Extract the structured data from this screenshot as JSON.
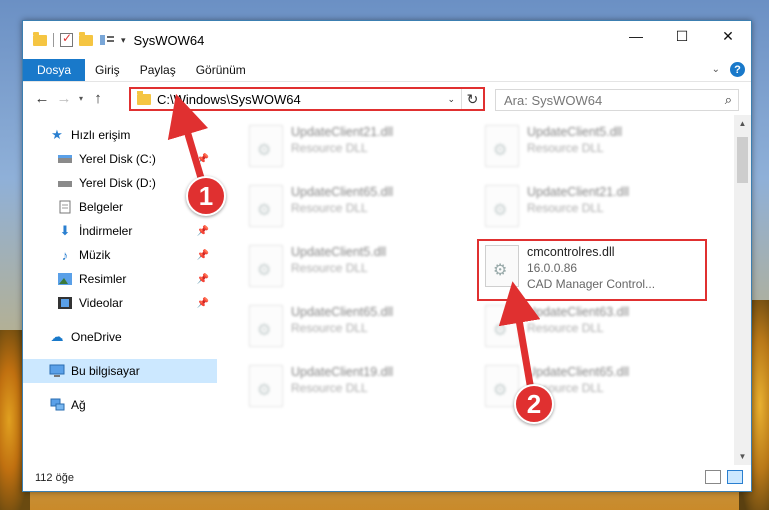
{
  "window": {
    "title": "SysWOW64",
    "controls": {
      "minimize": "—",
      "maximize": "☐",
      "close": "✕"
    }
  },
  "ribbon": {
    "tabs": [
      {
        "label": "Dosya",
        "active": true
      },
      {
        "label": "Giriş"
      },
      {
        "label": "Paylaş"
      },
      {
        "label": "Görünüm"
      }
    ],
    "help_icon": "?"
  },
  "address": {
    "path": "C:\\Windows\\SysWOW64",
    "search_placeholder": "Ara: SysWOW64"
  },
  "nav": {
    "quick_access": "Hızlı erişim",
    "items": [
      {
        "label": "Yerel Disk (C:)",
        "icon": "drive-icon",
        "pinned": true
      },
      {
        "label": "Yerel Disk (D:)",
        "icon": "drive-icon",
        "pinned": false
      },
      {
        "label": "Belgeler",
        "icon": "documents-icon",
        "pinned": true
      },
      {
        "label": "İndirmeler",
        "icon": "download-icon",
        "pinned": true
      },
      {
        "label": "Müzik",
        "icon": "music-icon",
        "pinned": true
      },
      {
        "label": "Resimler",
        "icon": "pictures-icon",
        "pinned": true
      },
      {
        "label": "Videolar",
        "icon": "video-icon",
        "pinned": true
      }
    ],
    "onedrive": "OneDrive",
    "this_pc": "Bu bilgisayar",
    "network": "Ağ"
  },
  "files": [
    {
      "name": "UpdateClient21.dll",
      "desc": "Resource DLL",
      "blurred": true
    },
    {
      "name": "UpdateClient5.dll",
      "desc": "Resource DLL",
      "blurred": true
    },
    {
      "name": "UpdateClient65.dll",
      "desc": "Resource DLL",
      "blurred": true
    },
    {
      "name": "UpdateClient21.dll",
      "desc": "Resource DLL",
      "blurred": true
    },
    {
      "name": "UpdateClient5.dll",
      "desc": "Resource DLL",
      "blurred": true
    },
    {
      "name": "cmcontrolres.dll",
      "version": "16.0.0.86",
      "desc": "CAD Manager Control...",
      "blurred": false,
      "highlighted": true
    },
    {
      "name": "UpdateClient65.dll",
      "desc": "Resource DLL",
      "blurred": true
    },
    {
      "name": "UpdateClient63.dll",
      "desc": "Resource DLL",
      "blurred": true
    },
    {
      "name": "UpdateClient19.dll",
      "desc": "Resource DLL",
      "blurred": true
    },
    {
      "name": "UpdateClient65.dll",
      "desc": "Resource DLL",
      "blurred": true
    }
  ],
  "status": {
    "count": "112 öğe"
  },
  "annotations": {
    "step1": "1",
    "step2": "2",
    "color": "#e03030"
  }
}
